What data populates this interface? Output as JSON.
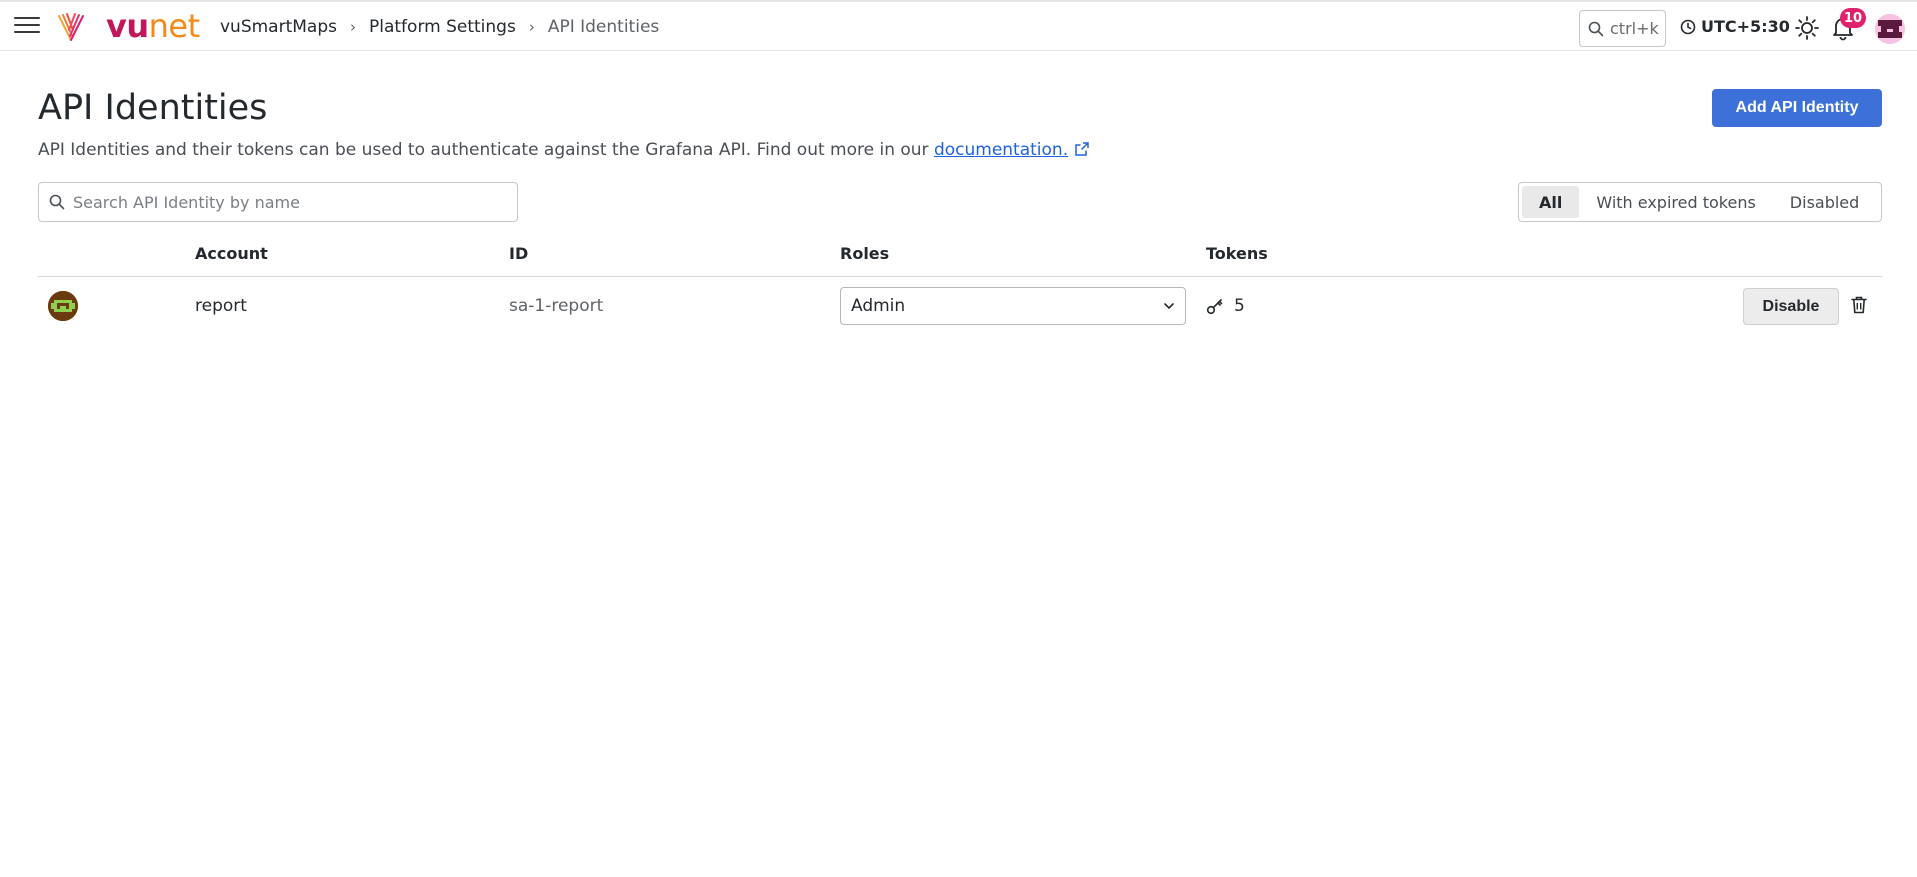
{
  "topbar": {
    "logo": {
      "part1": "vu",
      "part2": "net"
    },
    "breadcrumb": [
      "vuSmartMaps",
      "Platform Settings",
      "API Identities"
    ],
    "search_shortcut": "ctrl+k",
    "timezone": "UTC+5:30",
    "notifications_count": "10",
    "icons": [
      "menu-icon",
      "search-icon",
      "clock-icon",
      "sun-icon",
      "bell-icon"
    ]
  },
  "page": {
    "title": "API Identities",
    "subtitle_text": "API Identities and their tokens can be used to authenticate against the Grafana API. Find out more in our ",
    "subtitle_link": "documentation.",
    "add_button": "Add API Identity"
  },
  "search": {
    "placeholder": "Search API Identity by name",
    "value": ""
  },
  "filters": {
    "items": [
      "All",
      "With expired tokens",
      "Disabled"
    ],
    "selected": "All"
  },
  "table": {
    "columns": [
      "Account",
      "ID",
      "Roles",
      "Tokens"
    ],
    "rows": [
      {
        "account": "report",
        "id": "sa-1-report",
        "role": "Admin",
        "tokens": "5",
        "action": "Disable"
      }
    ]
  },
  "colors": {
    "primary": "#3d71d9",
    "link": "#1f62e0",
    "badge": "#e0226e",
    "logo_vu": "#c2185b",
    "logo_net": "#f28a1a"
  }
}
